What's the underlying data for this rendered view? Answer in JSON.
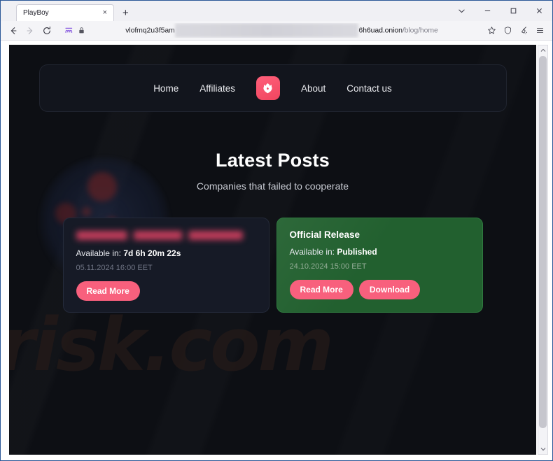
{
  "browser": {
    "tab": {
      "title": "PlayBoy",
      "close_label": "×"
    },
    "new_tab_label": "+",
    "window_controls": {
      "list_tabs": "chevron-down",
      "minimize": "–",
      "maximize": "□",
      "close": "✕"
    },
    "toolbar": {
      "back": "←",
      "forward": "→",
      "reload": "↻",
      "circuit_icon": "tor-circuit-icon",
      "lock_icon": "lock-icon",
      "bookmark_icon": "star-icon",
      "shield_icon": "shield-icon",
      "newidentity_icon": "broom-icon",
      "menu_icon": "hamburger-menu-icon"
    },
    "url": {
      "prefix": "vlofmq2u3f5am",
      "redacted": " ",
      "host": "6h6uad.onion",
      "path": "/blog/home"
    }
  },
  "site": {
    "nav": {
      "links_left": [
        {
          "label": "Home"
        },
        {
          "label": "Affiliates"
        }
      ],
      "logo_name": "playboy-shield-logo",
      "links_right": [
        {
          "label": "About"
        },
        {
          "label": "Contact us"
        }
      ]
    },
    "hero": {
      "title": "Latest Posts",
      "subtitle": "Companies that failed to cooperate"
    },
    "watermark": "risk.com",
    "cards": [
      {
        "title": "",
        "title_censored": true,
        "available_label": "Available in:",
        "available_value": "7d 6h 20m 22s",
        "date": "05.11.2024 16:00 EET",
        "buttons": [
          {
            "label": "Read More"
          }
        ]
      },
      {
        "title": "Official Release",
        "title_censored": false,
        "available_label": "Available in:",
        "available_value": "Published",
        "date": "24.10.2024 15:00 EET",
        "buttons": [
          {
            "label": "Read More"
          },
          {
            "label": "Download"
          }
        ]
      }
    ]
  },
  "colors": {
    "accent_pink": "#f8607d",
    "card_green": "#22602f",
    "card_dark": "#161a26",
    "page_bg": "#0d0f14"
  }
}
